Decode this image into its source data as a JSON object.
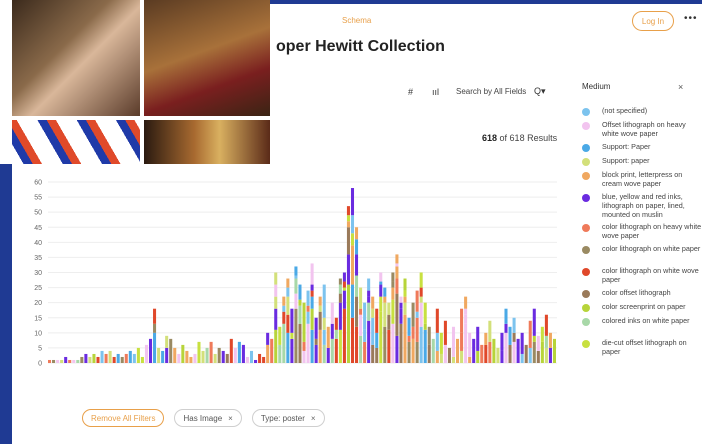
{
  "header": {
    "schema_link": "Schema",
    "login_button": "Log In",
    "more_icon": "•••",
    "page_title": "oper Hewitt Collection"
  },
  "toolbar": {
    "hash_icon": "#",
    "chart_icon": "ııl",
    "search_label": "Search by All Fields",
    "search_icon": "Q▾",
    "results_count": "618",
    "results_text": "of 618 Results"
  },
  "legend": {
    "title": "Medium",
    "close": "×",
    "items": [
      {
        "label": "(not specified)",
        "color": "#7cc3ee"
      },
      {
        "label": "Offset lithograph on heavy white wove paper",
        "color": "#f2c4ef"
      },
      {
        "label": "Support: Paper",
        "color": "#4aa9e6"
      },
      {
        "label": "Support: paper",
        "color": "#d3e07a"
      },
      {
        "label": "block print, letterpress on cream wove paper",
        "color": "#f0a860"
      },
      {
        "label": "blue, yellow and red inks, lithograph on paper, lined, mounted on muslin",
        "color": "#6a2be0"
      },
      {
        "label": "color lithograph on heavy white wove paper",
        "color": "#ef7a5a"
      },
      {
        "label": "color lithograph on white paper",
        "color": "#9a8a62"
      },
      {
        "label": "color lithograph on white wove paper",
        "color": "#e0482a"
      },
      {
        "label": "color offset lithograph",
        "color": "#9a7a5a"
      },
      {
        "label": "color screenprint on paper",
        "color": "#b7d43a"
      },
      {
        "label": "colored inks on white paper",
        "color": "#a8d8a8"
      },
      {
        "label": "die-cut offset lithograph on paper",
        "color": "#c8e040"
      }
    ]
  },
  "filters": {
    "remove_all": "Remove All Filters",
    "chips": [
      {
        "label": "Has Image",
        "close": "×"
      },
      {
        "label": "Type: poster",
        "close": "×"
      }
    ]
  },
  "chart_data": {
    "type": "bar",
    "stacked": true,
    "y_ticks": [
      "0",
      "5",
      "10",
      "15",
      "20",
      "25",
      "30",
      "35",
      "40",
      "45",
      "50",
      "55",
      "60"
    ],
    "ylim": [
      0,
      60
    ],
    "grid": true,
    "values": [
      1,
      1,
      1,
      1,
      2,
      1,
      1,
      1,
      2,
      3,
      2,
      3,
      2,
      4,
      3,
      4,
      2,
      3,
      2,
      3,
      4,
      3,
      5,
      2,
      6,
      8,
      18,
      5,
      4,
      9,
      8,
      5,
      3,
      6,
      4,
      2,
      3,
      7,
      4,
      5,
      7,
      3,
      5,
      4,
      3,
      8,
      5,
      7,
      6,
      2,
      4,
      1,
      3,
      2,
      10,
      8,
      30,
      12,
      22,
      28,
      18,
      32,
      26,
      20,
      24,
      33,
      15,
      22,
      26,
      12,
      20,
      15,
      28,
      30,
      52,
      58,
      45,
      25,
      20,
      28,
      22,
      18,
      30,
      25,
      20,
      30,
      36,
      22,
      28,
      15,
      20,
      24,
      30,
      20,
      12,
      8,
      18,
      10,
      14,
      5,
      12,
      8,
      18,
      22,
      10,
      8,
      12,
      6,
      10,
      14,
      8,
      5,
      10,
      18,
      12,
      15,
      8,
      10,
      6,
      14,
      18,
      9,
      12,
      16,
      10,
      8
    ]
  }
}
